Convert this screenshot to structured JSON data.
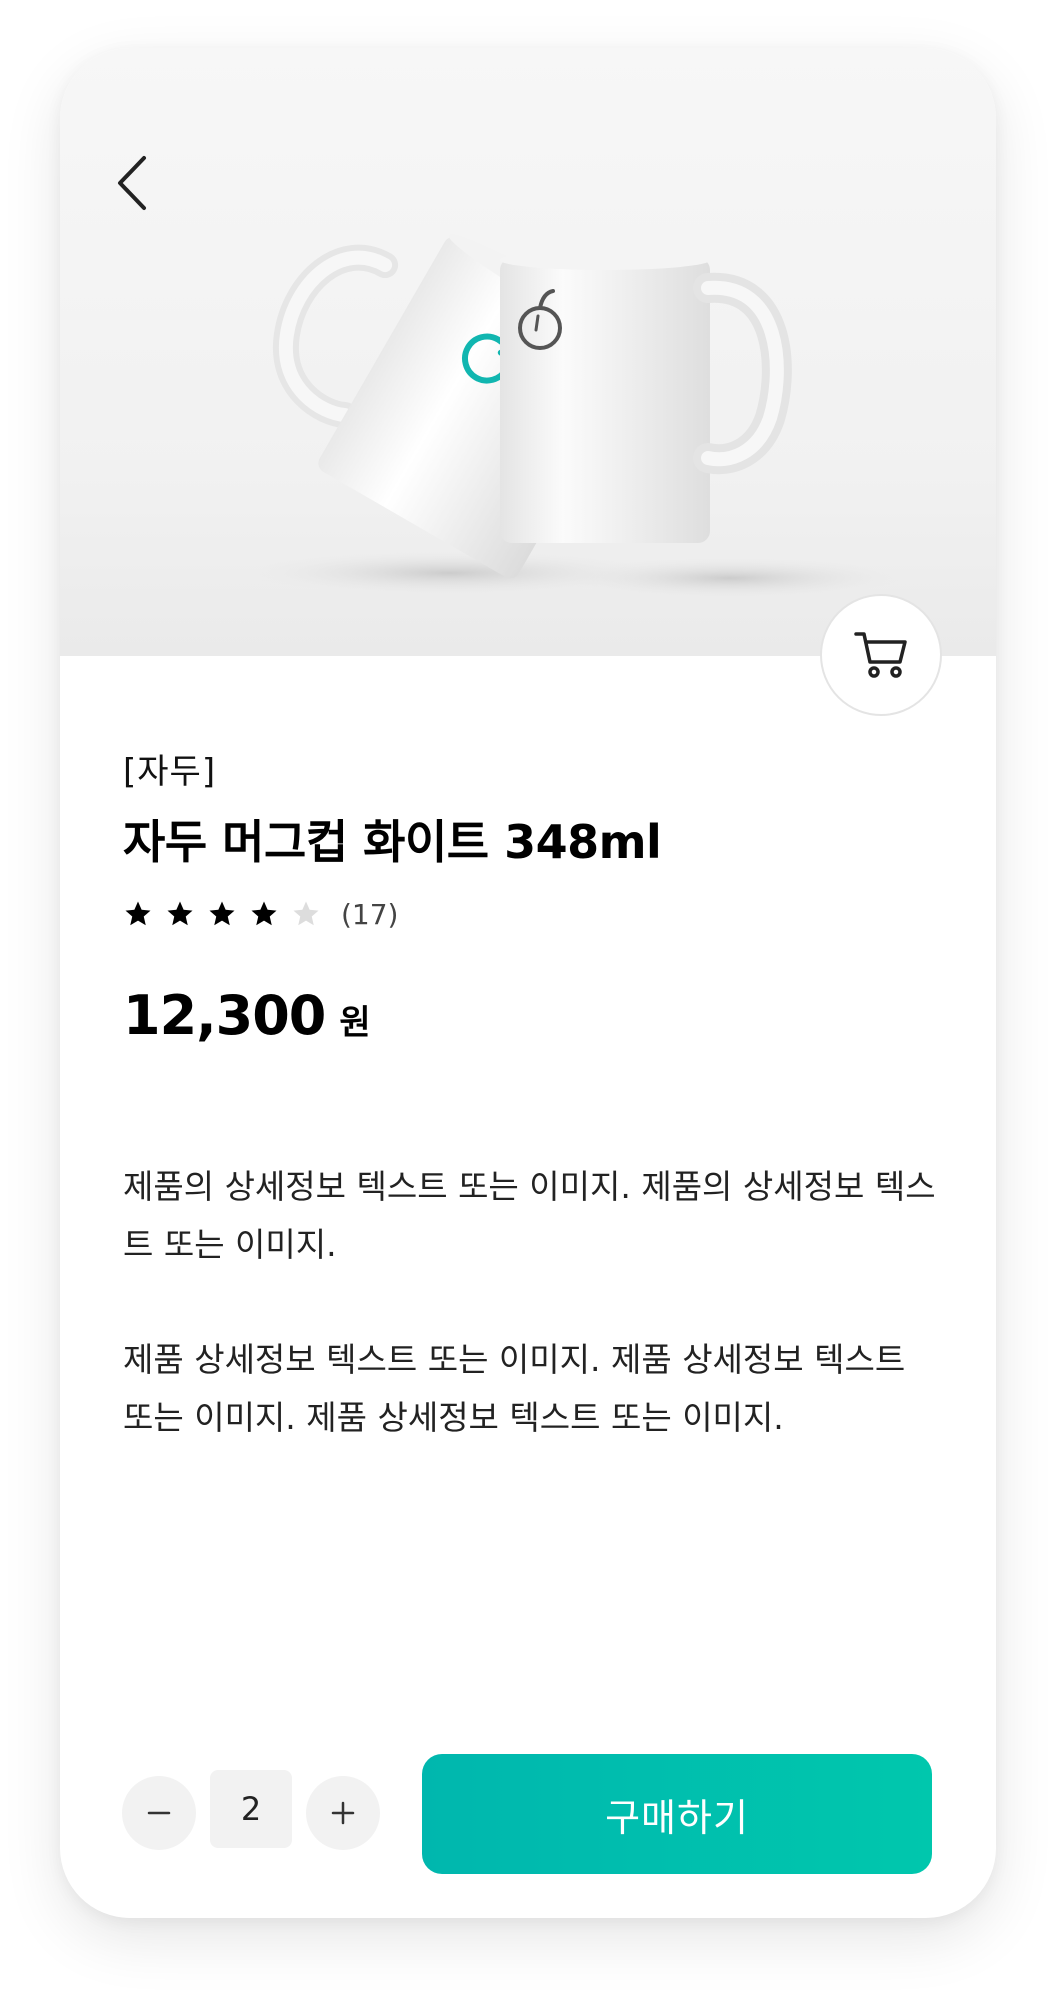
{
  "product": {
    "brand": "[자두]",
    "title": "자두 머그컵 화이트 348ml",
    "rating": 4,
    "rating_max": 5,
    "review_count": "(17)",
    "price": "12,300",
    "price_unit": "원",
    "description_1": "제품의 상세정보 텍스트 또는 이미지. 제품의 상세정보 텍스트 또는 이미지.",
    "description_2": "제품 상세정보 텍스트 또는 이미지. 제품 상세정보 텍스트 또는 이미지. 제품 상세정보 텍스트 또는 이미지."
  },
  "purchase": {
    "quantity": "2",
    "buy_label": "구매하기"
  },
  "colors": {
    "accent": "#00bfad",
    "star_filled": "#000000",
    "star_empty": "#dddddd"
  },
  "icons": {
    "back": "chevron-left-icon",
    "cart": "cart-icon",
    "minus": "minus-icon",
    "plus": "plus-icon",
    "star": "star-icon"
  }
}
